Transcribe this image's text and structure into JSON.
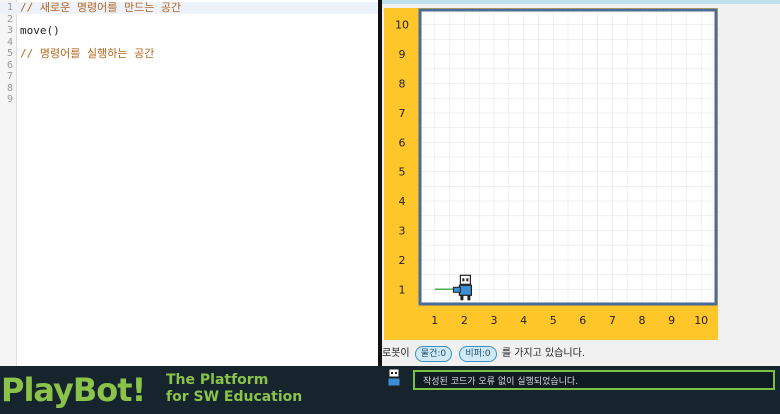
{
  "editor": {
    "lines": [
      {
        "num": "1",
        "text": "// 새로운 명령어를 만드는 공간",
        "kind": "comment",
        "active": true
      },
      {
        "num": "2",
        "text": "",
        "kind": "code",
        "active": false
      },
      {
        "num": "3",
        "text": "move()",
        "kind": "code",
        "active": false
      },
      {
        "num": "4",
        "text": "",
        "kind": "code",
        "active": false
      },
      {
        "num": "5",
        "text": "// 명령어를 실행하는 공간",
        "kind": "comment",
        "active": false
      },
      {
        "num": "6",
        "text": "",
        "kind": "code",
        "active": false
      },
      {
        "num": "7",
        "text": "",
        "kind": "code",
        "active": false
      },
      {
        "num": "8",
        "text": "",
        "kind": "code",
        "active": false
      },
      {
        "num": "9",
        "text": "",
        "kind": "code",
        "active": false
      }
    ]
  },
  "board": {
    "x_labels": [
      "1",
      "2",
      "3",
      "4",
      "5",
      "6",
      "7",
      "8",
      "9",
      "10"
    ],
    "y_labels": [
      "1",
      "2",
      "3",
      "4",
      "5",
      "6",
      "7",
      "8",
      "9",
      "10"
    ],
    "grid_size": 10,
    "robot": {
      "col": 2,
      "row": 1,
      "facing": "left",
      "icon": "robot-icon"
    },
    "trail": {
      "from_col": 1,
      "to_col": 2,
      "row": 1
    },
    "colors": {
      "frame": "#ffc62a",
      "border": "#4a6a9a",
      "grid": "#e6e6e6",
      "trail": "#4caf50"
    }
  },
  "status": {
    "prefix": "로봇이",
    "item1": "물건:0",
    "item2": "비퍼:0",
    "suffix": "를 가지고 있습니다."
  },
  "footer": {
    "brand": "PlayBot!",
    "tagline_line1": "The Platform",
    "tagline_line2": "for SW Education",
    "console_message": "작성된 코드가 오류 없이 실행되었습니다.",
    "colors": {
      "brand": "#8bc34a",
      "background": "#16242d"
    }
  }
}
